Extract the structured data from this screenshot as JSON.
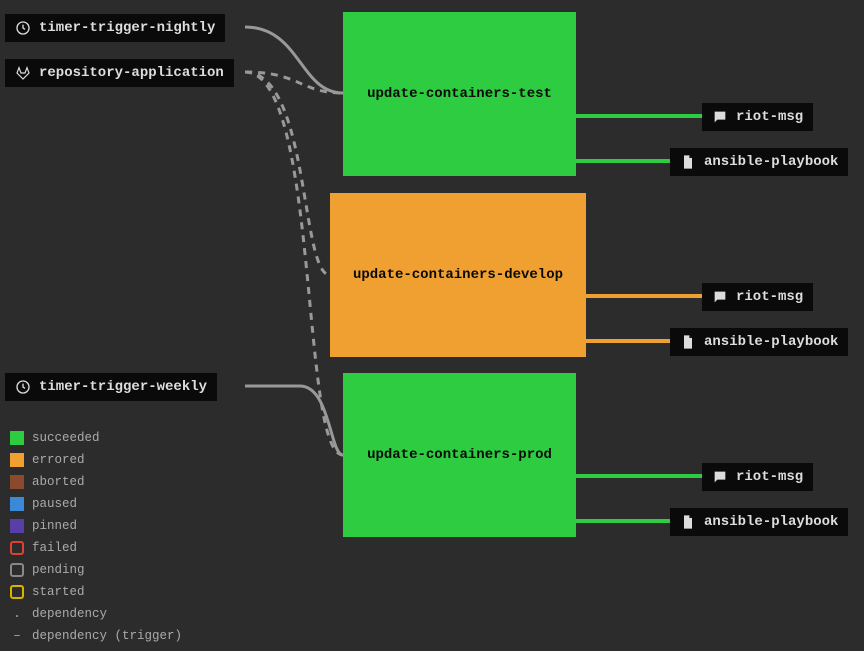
{
  "triggers": [
    {
      "id": "timer-trigger-nightly",
      "label": "timer-trigger-nightly",
      "icon": "clock"
    },
    {
      "id": "repository-application",
      "label": "repository-application",
      "icon": "gitlab"
    },
    {
      "id": "timer-trigger-weekly",
      "label": "timer-trigger-weekly",
      "icon": "clock"
    }
  ],
  "jobs": [
    {
      "id": "update-containers-test",
      "label": "update-containers-test",
      "status": "succeeded"
    },
    {
      "id": "update-containers-develop",
      "label": "update-containers-develop",
      "status": "errored"
    },
    {
      "id": "update-containers-prod",
      "label": "update-containers-prod",
      "status": "succeeded"
    }
  ],
  "outputs": {
    "test": [
      {
        "id": "riot-msg-test",
        "label": "riot-msg",
        "icon": "chat"
      },
      {
        "id": "ansible-playbook-test",
        "label": "ansible-playbook",
        "icon": "file"
      }
    ],
    "develop": [
      {
        "id": "riot-msg-develop",
        "label": "riot-msg",
        "icon": "chat"
      },
      {
        "id": "ansible-playbook-develop",
        "label": "ansible-playbook",
        "icon": "file"
      }
    ],
    "prod": [
      {
        "id": "riot-msg-prod",
        "label": "riot-msg",
        "icon": "chat"
      },
      {
        "id": "ansible-playbook-prod",
        "label": "ansible-playbook",
        "icon": "file"
      }
    ]
  },
  "legend": [
    {
      "label": "succeeded",
      "type": "swatch",
      "color": "#2ecc40"
    },
    {
      "label": "errored",
      "type": "swatch",
      "color": "#f0a030"
    },
    {
      "label": "aborted",
      "type": "swatch",
      "color": "#8b4a2b"
    },
    {
      "label": "paused",
      "type": "swatch",
      "color": "#3b8ad8"
    },
    {
      "label": "pinned",
      "type": "swatch",
      "color": "#5a3ea8"
    },
    {
      "label": "failed",
      "type": "outline",
      "color": "#e04030"
    },
    {
      "label": "pending",
      "type": "outline",
      "color": "#888888"
    },
    {
      "label": "started",
      "type": "outline",
      "color": "#d8b400"
    },
    {
      "label": "dependency",
      "type": "dot"
    },
    {
      "label": "dependency (trigger)",
      "type": "dash"
    }
  ],
  "colors": {
    "succeeded": "#2ecc40",
    "errored": "#f0a030"
  }
}
